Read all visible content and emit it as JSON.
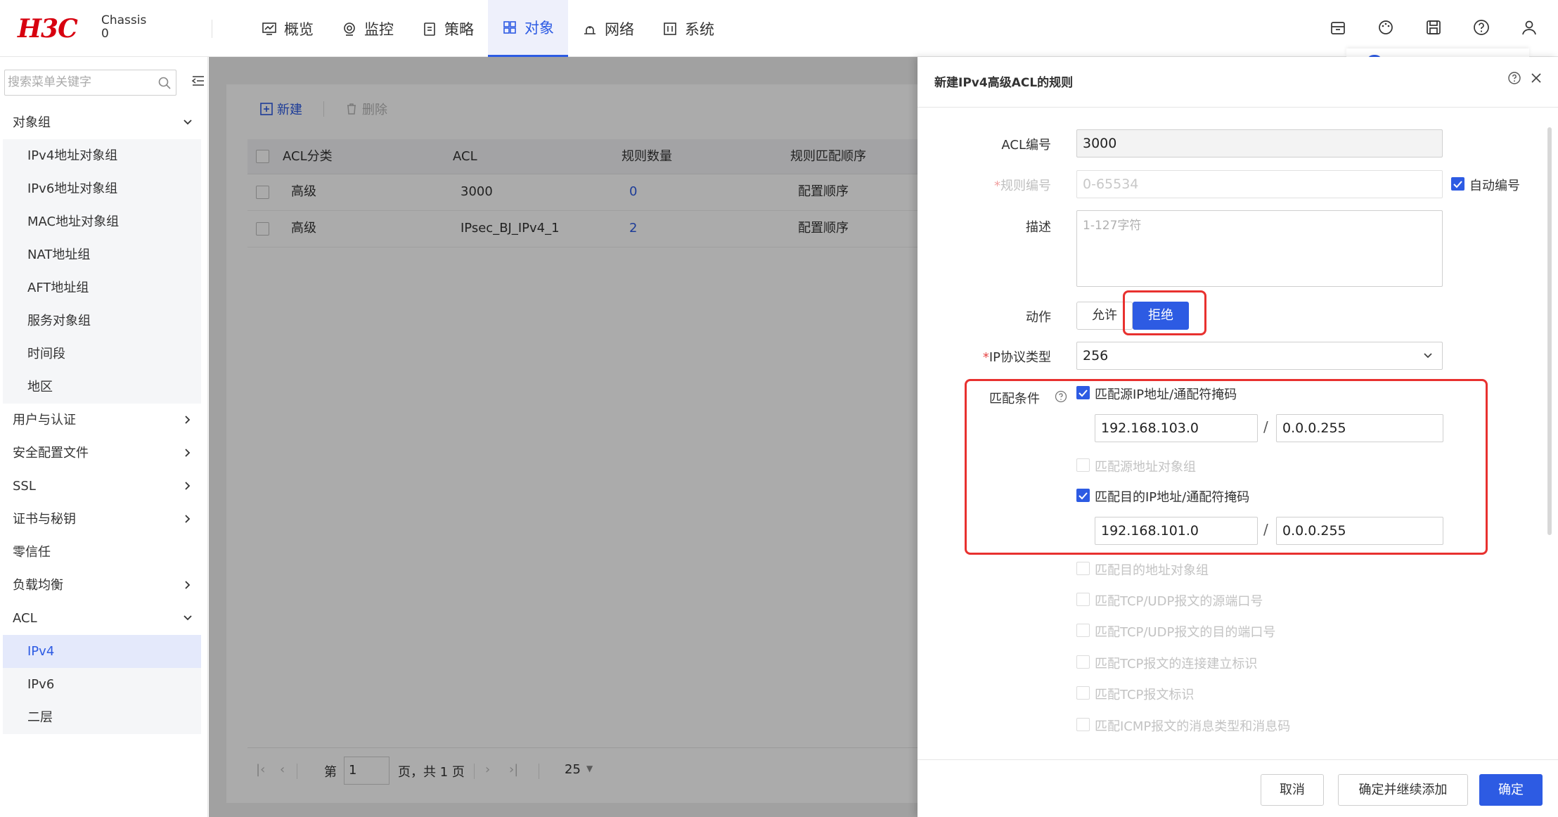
{
  "header": {
    "logo": "H3C",
    "chassis_line1": "Chassis",
    "chassis_line2": "0",
    "nav": [
      {
        "label": "概览",
        "icon": "dashboard-icon"
      },
      {
        "label": "监控",
        "icon": "monitor-icon"
      },
      {
        "label": "策略",
        "icon": "policy-icon"
      },
      {
        "label": "对象",
        "icon": "objects-icon",
        "active": true
      },
      {
        "label": "网络",
        "icon": "network-icon"
      },
      {
        "label": "系统",
        "icon": "system-icon"
      }
    ],
    "right_icons": [
      "package-icon",
      "palette-icon",
      "save-icon",
      "help-icon",
      "user-icon"
    ]
  },
  "sidebar": {
    "search_placeholder": "搜索菜单关键字",
    "items": [
      {
        "label": "对象组",
        "expanded": true
      },
      {
        "label": "IPv4地址对象组"
      },
      {
        "label": "IPv6地址对象组"
      },
      {
        "label": "MAC地址对象组"
      },
      {
        "label": "NAT地址组"
      },
      {
        "label": "AFT地址组"
      },
      {
        "label": "服务对象组"
      },
      {
        "label": "时间段"
      },
      {
        "label": "地区"
      },
      {
        "label": "用户与认证"
      },
      {
        "label": "安全配置文件"
      },
      {
        "label": "SSL"
      },
      {
        "label": "证书与秘钥"
      },
      {
        "label": "零信任"
      },
      {
        "label": "负载均衡"
      },
      {
        "label": "ACL",
        "expanded": true
      },
      {
        "label": "IPv4",
        "selected": true
      },
      {
        "label": "IPv6"
      },
      {
        "label": "二层"
      }
    ]
  },
  "list": {
    "new_label": "新建",
    "delete_label": "删除",
    "columns": [
      "ACL分类",
      "ACL",
      "规则数量",
      "规则匹配顺序"
    ],
    "rows": [
      {
        "category": "高级",
        "acl": "3000",
        "count": "0",
        "order": "配置顺序"
      },
      {
        "category": "高级",
        "acl": "IPsec_BJ_IPv4_1",
        "count": "2",
        "order": "配置顺序"
      }
    ],
    "pager": {
      "page_prefix": "第",
      "page_value": "1",
      "page_suffix": "页，共 1 页",
      "page_size": "25"
    }
  },
  "drawer": {
    "title": "新建IPv4高级ACL的规则",
    "acl_no_label": "ACL编号",
    "acl_no_value": "3000",
    "rule_no_label": "规则编号",
    "rule_no_placeholder": "0-65534",
    "auto_no_label": "自动编号",
    "desc_label": "描述",
    "desc_placeholder": "1-127字符",
    "action_label": "动作",
    "action_permit": "允许",
    "action_deny": "拒绝",
    "proto_label": "IP协议类型",
    "proto_value": "256",
    "match_label": "匹配条件",
    "match_src": "匹配源IP地址/通配符掩码",
    "src_ip": "192.168.103.0",
    "src_mask": "0.0.0.255",
    "match_src_group": "匹配源地址对象组",
    "match_dst": "匹配目的IP地址/通配符掩码",
    "dst_ip": "192.168.101.0",
    "dst_mask": "0.0.0.255",
    "slash": "/",
    "disabled_options": [
      "匹配目的地址对象组",
      "匹配TCP/UDP报文的源端口号",
      "匹配TCP/UDP报文的目的端口号",
      "匹配TCP报文的连接建立标识",
      "匹配TCP报文标识",
      "匹配ICMP报文的消息类型和消息码"
    ],
    "cancel_label": "取消",
    "confirm_continue_label": "确定并继续添加",
    "confirm_label": "确定",
    "highlight_color": "#e8312f"
  }
}
